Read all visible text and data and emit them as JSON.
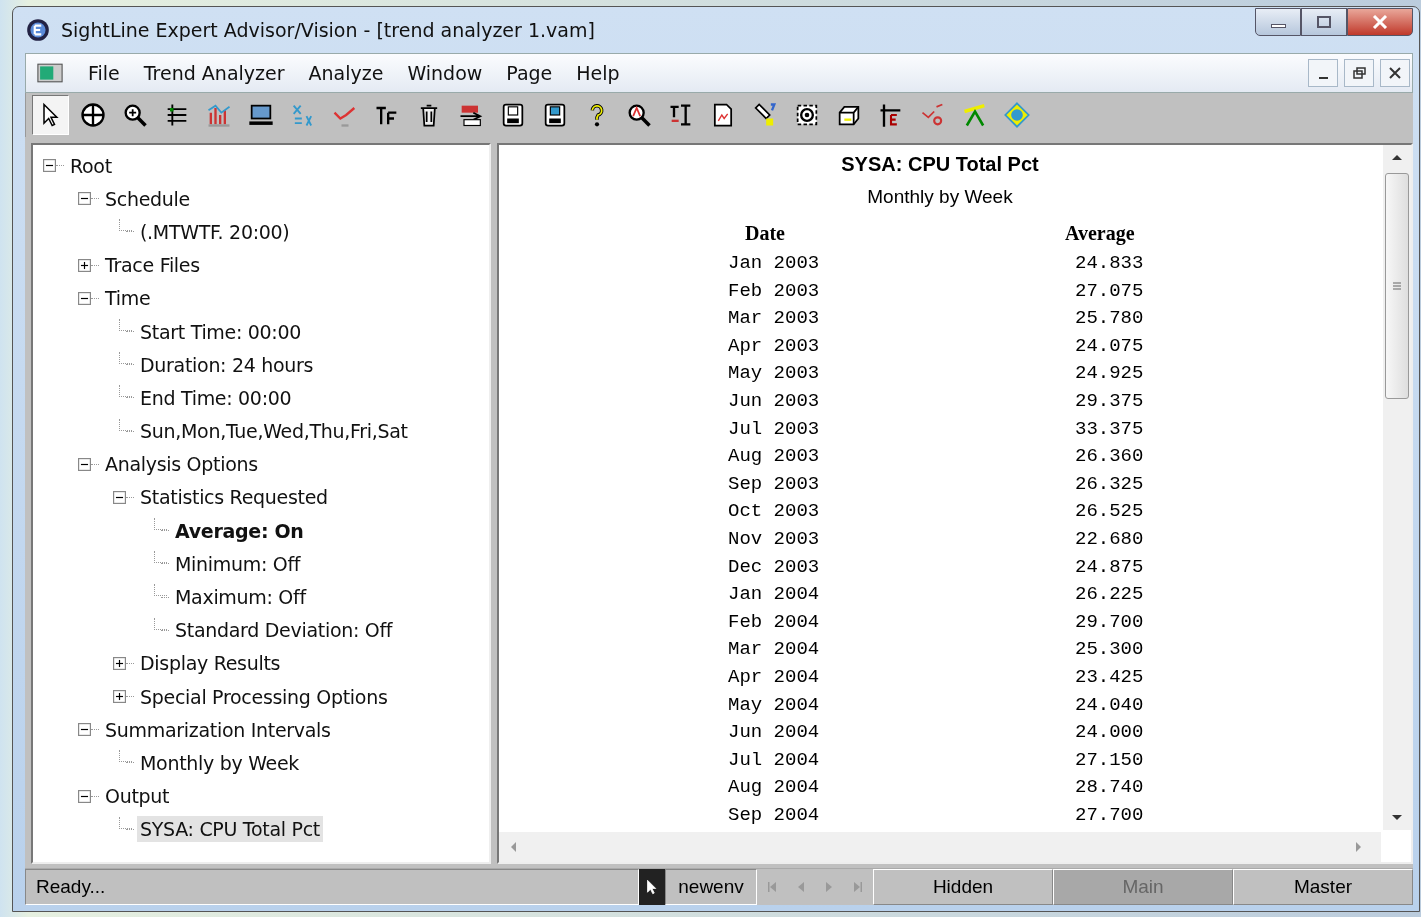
{
  "window": {
    "title": "SightLine Expert Advisor/Vision - [trend analyzer 1.vam]"
  },
  "menu": [
    {
      "label": "File"
    },
    {
      "label": "Trend Analyzer"
    },
    {
      "label": "Analyze"
    },
    {
      "label": "Window"
    },
    {
      "label": "Page"
    },
    {
      "label": "Help"
    }
  ],
  "toolbar": [
    {
      "selected": true
    },
    {
      "selected": false
    },
    {
      "selected": false
    },
    {
      "selected": false
    },
    {
      "selected": false
    },
    {
      "selected": false
    },
    {
      "selected": false
    },
    {
      "selected": false
    },
    {
      "selected": false
    },
    {
      "selected": false
    },
    {
      "selected": false
    },
    {
      "selected": false
    },
    {
      "selected": false
    },
    {
      "selected": false
    },
    {
      "selected": false
    },
    {
      "selected": false
    },
    {
      "selected": false
    },
    {
      "selected": false
    },
    {
      "selected": false
    },
    {
      "selected": false
    },
    {
      "selected": false
    },
    {
      "selected": false
    },
    {
      "selected": false
    },
    {
      "selected": false
    }
  ],
  "tree": [
    {
      "label": "Root",
      "expanded": true,
      "bold": false,
      "selected": false,
      "children": [
        {
          "label": "Schedule",
          "expanded": true,
          "bold": false,
          "selected": false,
          "children": [
            {
              "label": "(.MTWTF. 20:00)",
              "bold": false,
              "selected": false
            }
          ]
        },
        {
          "label": "Trace Files",
          "expanded": false,
          "bold": false,
          "selected": false
        },
        {
          "label": "Time",
          "expanded": true,
          "bold": false,
          "selected": false,
          "children": [
            {
              "label": "Start Time: 00:00",
              "bold": false,
              "selected": false
            },
            {
              "label": "Duration: 24 hours",
              "bold": false,
              "selected": false
            },
            {
              "label": "End Time: 00:00",
              "bold": false,
              "selected": false
            },
            {
              "label": "Sun,Mon,Tue,Wed,Thu,Fri,Sat",
              "bold": false,
              "selected": false
            }
          ]
        },
        {
          "label": "Analysis Options",
          "expanded": true,
          "bold": false,
          "selected": false,
          "children": [
            {
              "label": "Statistics Requested",
              "expanded": true,
              "bold": false,
              "selected": false,
              "children": [
                {
                  "label": "Average: On",
                  "bold": true,
                  "selected": false
                },
                {
                  "label": "Minimum: Off",
                  "bold": false,
                  "selected": false
                },
                {
                  "label": "Maximum: Off",
                  "bold": false,
                  "selected": false
                },
                {
                  "label": "Standard Deviation: Off",
                  "bold": false,
                  "selected": false
                }
              ]
            },
            {
              "label": "Display Results",
              "expanded": false,
              "bold": false,
              "selected": false
            },
            {
              "label": "Special Processing Options",
              "expanded": false,
              "bold": false,
              "selected": false
            }
          ]
        },
        {
          "label": "Summarization Intervals",
          "expanded": true,
          "bold": false,
          "selected": false,
          "children": [
            {
              "label": "Monthly by Week",
              "bold": false,
              "selected": false
            }
          ]
        },
        {
          "label": "Output",
          "expanded": true,
          "bold": false,
          "selected": false,
          "children": [
            {
              "label": "SYSA: CPU Total Pct",
              "bold": false,
              "selected": true
            }
          ]
        }
      ]
    }
  ],
  "report": {
    "title": "SYSA: CPU Total Pct",
    "subtitle": "Monthly by Week",
    "columns": [
      "Date",
      "Average"
    ],
    "rows": [
      [
        "Jan 2003",
        "24.833"
      ],
      [
        "Feb 2003",
        "27.075"
      ],
      [
        "Mar 2003",
        "25.780"
      ],
      [
        "Apr 2003",
        "24.075"
      ],
      [
        "May 2003",
        "24.925"
      ],
      [
        "Jun 2003",
        "29.375"
      ],
      [
        "Jul 2003",
        "33.375"
      ],
      [
        "Aug 2003",
        "26.360"
      ],
      [
        "Sep 2003",
        "26.325"
      ],
      [
        "Oct 2003",
        "26.525"
      ],
      [
        "Nov 2003",
        "22.680"
      ],
      [
        "Dec 2003",
        "24.875"
      ],
      [
        "Jan 2004",
        "26.225"
      ],
      [
        "Feb 2004",
        "29.700"
      ],
      [
        "Mar 2004",
        "25.300"
      ],
      [
        "Apr 2004",
        "23.425"
      ],
      [
        "May 2004",
        "24.040"
      ],
      [
        "Jun 2004",
        "24.000"
      ],
      [
        "Jul 2004",
        "27.150"
      ],
      [
        "Aug 2004",
        "28.740"
      ],
      [
        "Sep 2004",
        "27.700"
      ]
    ]
  },
  "status_bar": {
    "message": "Ready...",
    "environment": "newenv",
    "nav_disabled": true,
    "tabs": [
      {
        "label": "Hidden",
        "selected": false
      },
      {
        "label": "Main",
        "selected": true
      },
      {
        "label": "Master",
        "selected": false
      }
    ]
  }
}
